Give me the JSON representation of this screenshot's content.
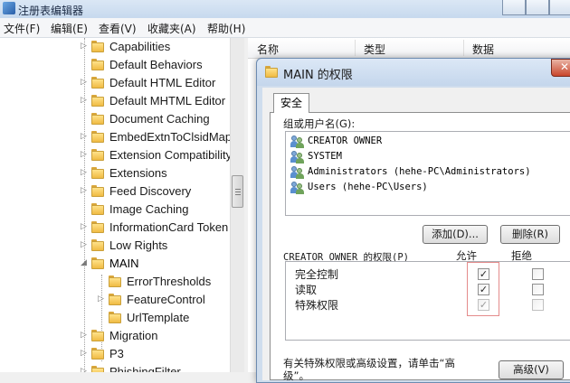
{
  "window": {
    "title": "注册表编辑器",
    "btn_close": "",
    "btn_min": "",
    "btn_max": ""
  },
  "menu": [
    "文件(F)",
    "编辑(E)",
    "查看(V)",
    "收藏夹(A)",
    "帮助(H)"
  ],
  "tree": {
    "items": [
      {
        "label": "Capabilities",
        "expander": "▷",
        "depth": 0
      },
      {
        "label": "Default Behaviors",
        "expander": "",
        "depth": 0
      },
      {
        "label": "Default HTML Editor",
        "expander": "▷",
        "depth": 0
      },
      {
        "label": "Default MHTML Editor",
        "expander": "▷",
        "depth": 0
      },
      {
        "label": "Document Caching",
        "expander": "",
        "depth": 0
      },
      {
        "label": "EmbedExtnToClsidMap",
        "expander": "▷",
        "depth": 0
      },
      {
        "label": "Extension Compatibility",
        "expander": "▷",
        "depth": 0
      },
      {
        "label": "Extensions",
        "expander": "▷",
        "depth": 0
      },
      {
        "label": "Feed Discovery",
        "expander": "▷",
        "depth": 0
      },
      {
        "label": "Image Caching",
        "expander": "",
        "depth": 0
      },
      {
        "label": "InformationCard Token",
        "expander": "▷",
        "depth": 0
      },
      {
        "label": "Low Rights",
        "expander": "▷",
        "depth": 0
      },
      {
        "label": "MAIN",
        "expander": "◢",
        "depth": 0
      },
      {
        "label": "ErrorThresholds",
        "expander": "",
        "depth": 1
      },
      {
        "label": "FeatureControl",
        "expander": "▷",
        "depth": 1
      },
      {
        "label": "UrlTemplate",
        "expander": "",
        "depth": 1
      },
      {
        "label": "Migration",
        "expander": "▷",
        "depth": 0
      },
      {
        "label": "P3",
        "expander": "▷",
        "depth": 0
      },
      {
        "label": "PhishingFilter",
        "expander": "▷",
        "depth": 0
      }
    ]
  },
  "list_pane": {
    "columns": [
      "名称",
      "类型",
      "数据"
    ]
  },
  "dialog": {
    "title": "MAIN 的权限",
    "close": "✕",
    "tab_label": "安全",
    "groups_label": "组或用户名(G):",
    "users": [
      "CREATOR OWNER",
      "SYSTEM",
      "Administrators (hehe-PC\\Administrators)",
      "Users (hehe-PC\\Users)"
    ],
    "add_button": "添加(D)...",
    "remove_button": "删除(R)",
    "perm_label": "CREATOR OWNER 的权限(P)",
    "allow_header": "允许",
    "deny_header": "拒绝",
    "permissions": [
      {
        "name": "完全控制",
        "allow": "✓",
        "deny": ""
      },
      {
        "name": "读取",
        "allow": "✓",
        "deny": ""
      },
      {
        "name": "特殊权限",
        "allow": "✓",
        "deny": ""
      }
    ],
    "advanced_hint": "有关特殊权限或高级设置，请单击“高级”。",
    "advanced_button": "高级(V)"
  }
}
